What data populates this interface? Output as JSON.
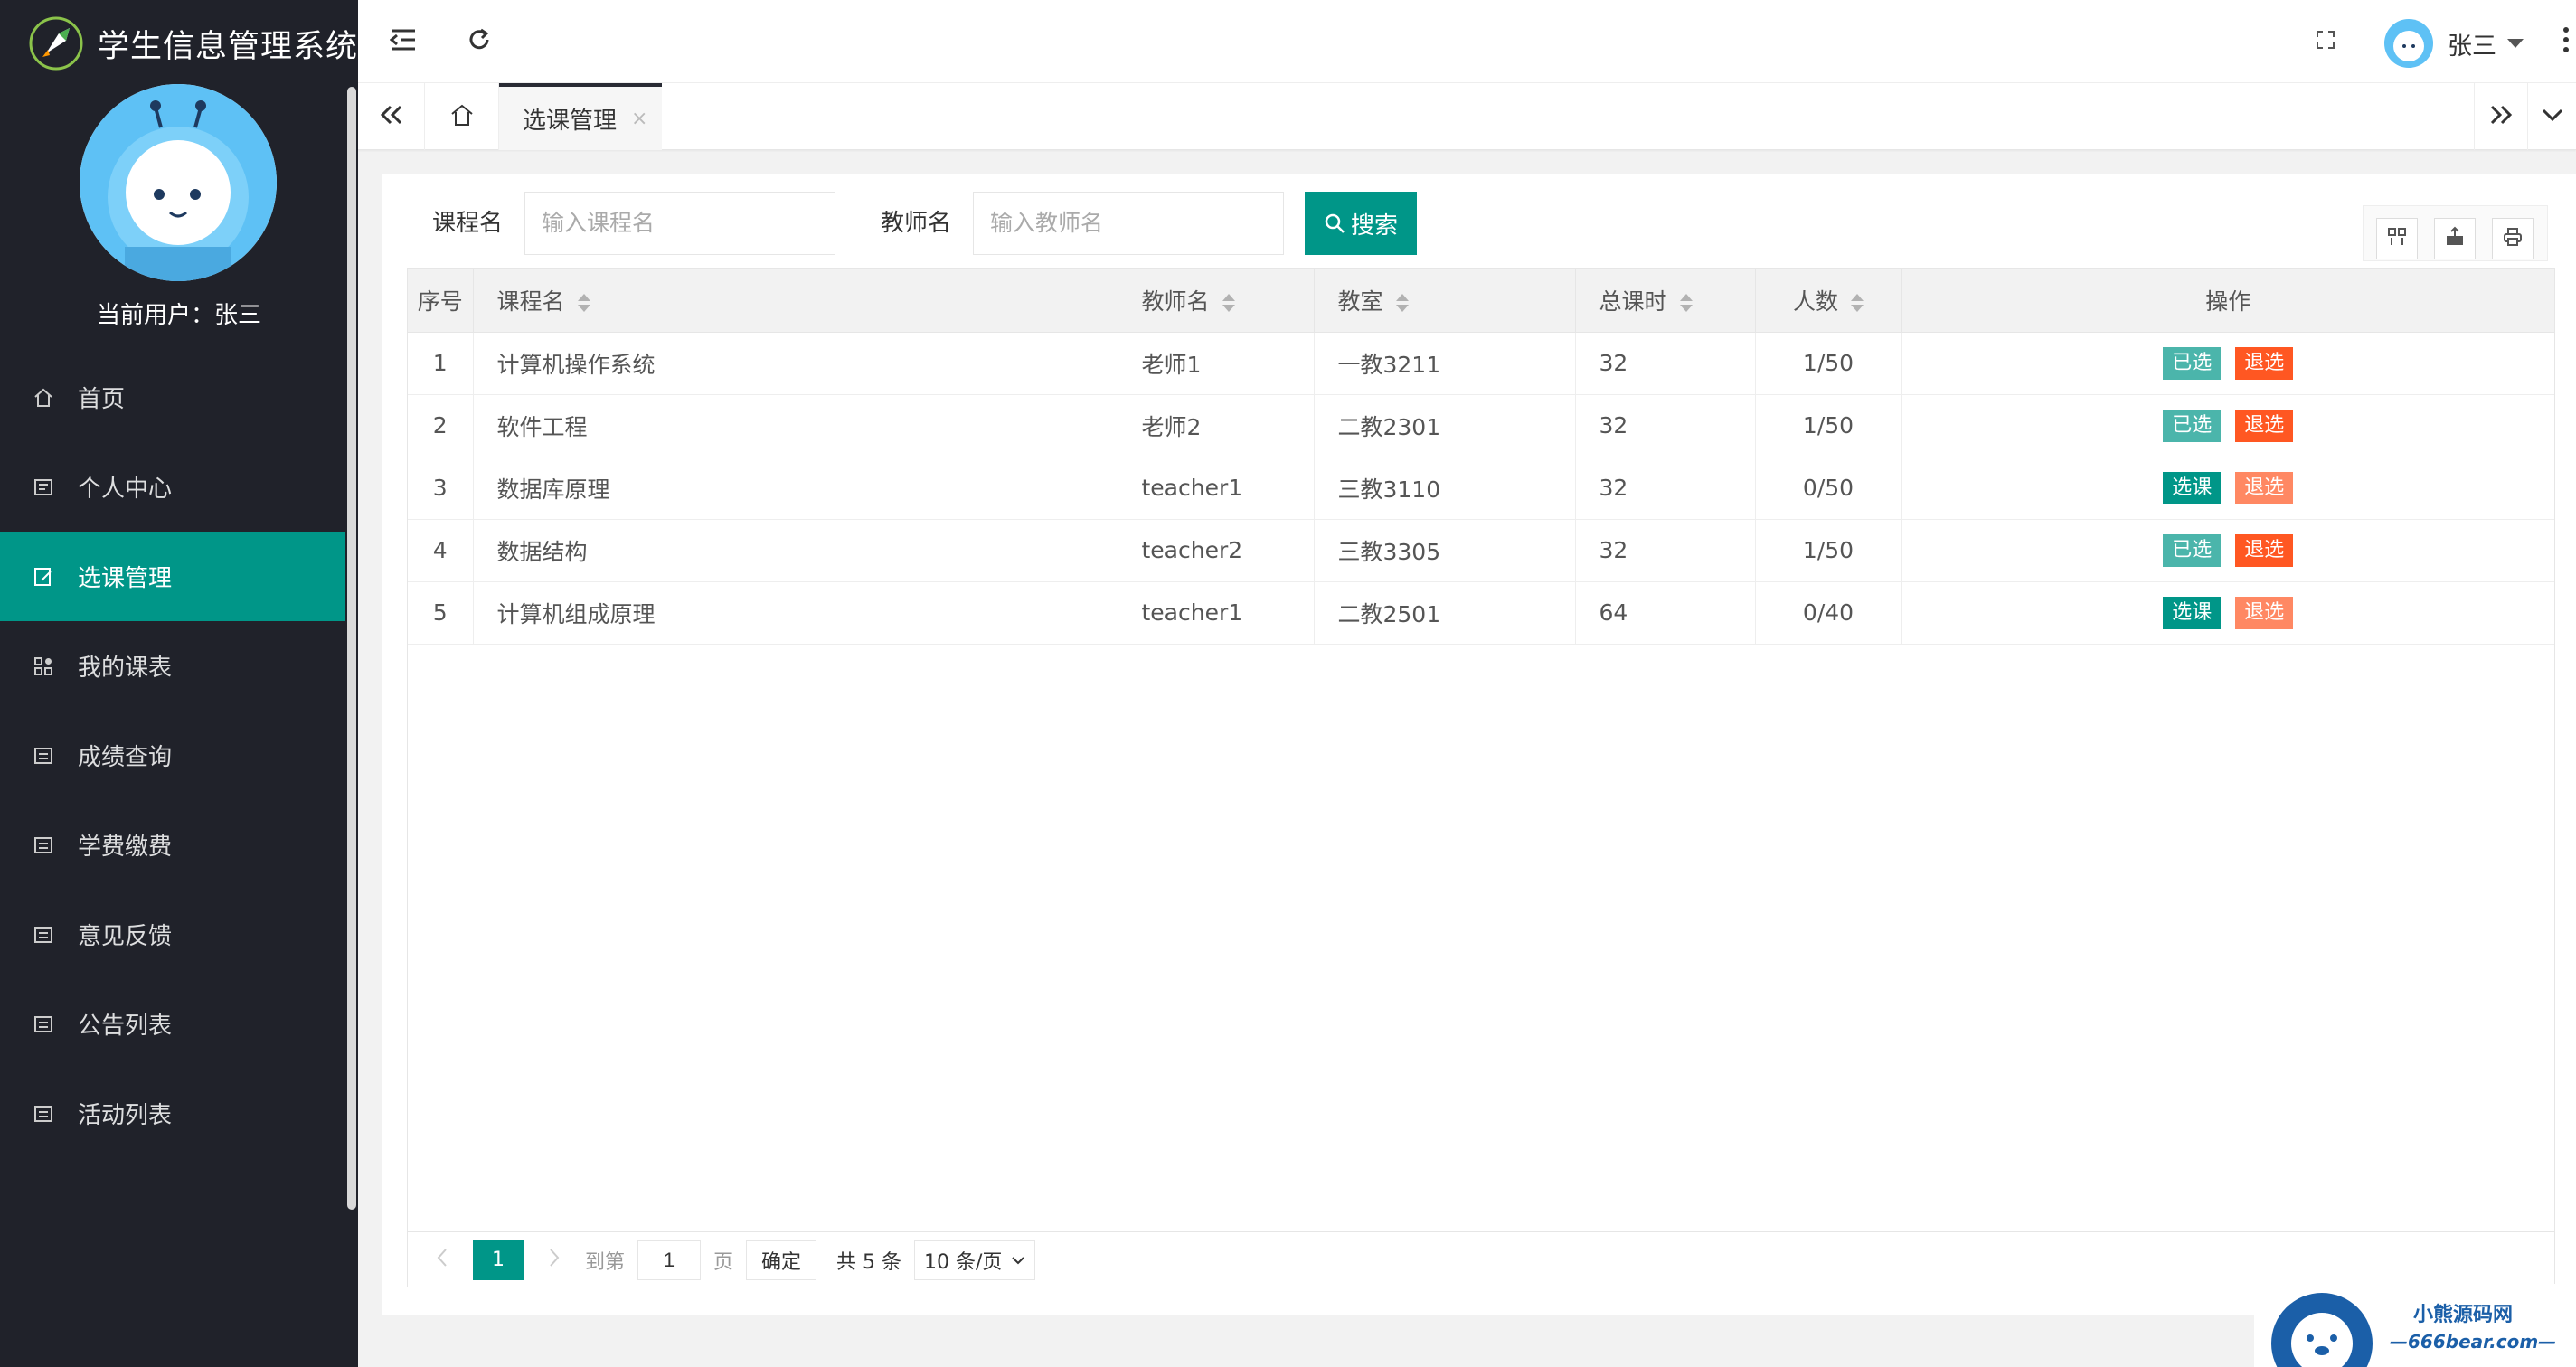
{
  "app": {
    "title": "学生信息管理系统",
    "current_user_label": "当前用户：张三"
  },
  "sidebar": {
    "items": [
      {
        "label": "首页",
        "icon": "home-icon",
        "active": false
      },
      {
        "label": "个人中心",
        "icon": "profile-icon",
        "active": false
      },
      {
        "label": "选课管理",
        "icon": "edit-icon",
        "active": true
      },
      {
        "label": "我的课表",
        "icon": "apps-icon",
        "active": false
      },
      {
        "label": "成绩查询",
        "icon": "list-icon",
        "active": false
      },
      {
        "label": "学费缴费",
        "icon": "list-icon",
        "active": false
      },
      {
        "label": "意见反馈",
        "icon": "list-icon",
        "active": false
      },
      {
        "label": "公告列表",
        "icon": "list-icon",
        "active": false
      },
      {
        "label": "活动列表",
        "icon": "list-icon",
        "active": false
      }
    ]
  },
  "header": {
    "user_name": "张三"
  },
  "tabs": {
    "active_label": "选课管理",
    "close_glyph": "×"
  },
  "search": {
    "course_label": "课程名",
    "course_placeholder": "输入课程名",
    "teacher_label": "教师名",
    "teacher_placeholder": "输入教师名",
    "button_label": "搜索"
  },
  "table": {
    "columns": [
      "序号",
      "课程名",
      "教师名",
      "教室",
      "总课时",
      "人数",
      "操作"
    ],
    "rows": [
      {
        "no": "1",
        "course": "计算机操作系统",
        "teacher": "老师1",
        "room": "一教3211",
        "hours": "32",
        "count": "1/50",
        "select": "已选",
        "drop": "退选",
        "selected": true
      },
      {
        "no": "2",
        "course": "软件工程",
        "teacher": "老师2",
        "room": "二教2301",
        "hours": "32",
        "count": "1/50",
        "select": "已选",
        "drop": "退选",
        "selected": true
      },
      {
        "no": "3",
        "course": "数据库原理",
        "teacher": "teacher1",
        "room": "三教3110",
        "hours": "32",
        "count": "0/50",
        "select": "选课",
        "drop": "退选",
        "selected": false
      },
      {
        "no": "4",
        "course": "数据结构",
        "teacher": "teacher2",
        "room": "三教3305",
        "hours": "32",
        "count": "1/50",
        "select": "已选",
        "drop": "退选",
        "selected": true
      },
      {
        "no": "5",
        "course": "计算机组成原理",
        "teacher": "teacher1",
        "room": "二教2501",
        "hours": "64",
        "count": "0/40",
        "select": "选课",
        "drop": "退选",
        "selected": false
      }
    ]
  },
  "pager": {
    "current_page": "1",
    "goto_label": "到第",
    "page_input": "1",
    "page_unit": "页",
    "confirm_label": "确定",
    "total_label": "共 5 条",
    "page_size": "10 条/页"
  },
  "watermark": {
    "line1": "小熊源码网",
    "line2": "—666bear.com—"
  },
  "colors": {
    "primary": "#009688",
    "danger": "#ff5722",
    "sidebar_bg": "#20222a"
  }
}
